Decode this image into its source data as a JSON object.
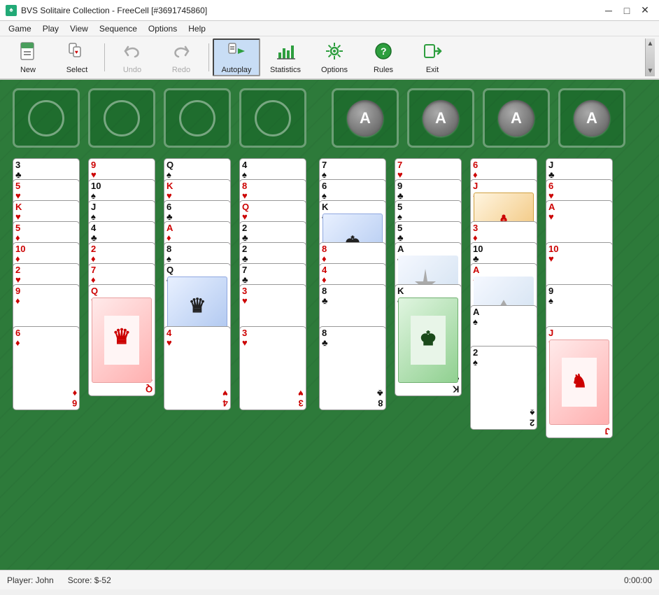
{
  "window": {
    "title": "BVS Solitaire Collection  -  FreeCell [#3691745860]",
    "app_name": "BVS Solitaire Collection",
    "subtitle": "FreeCell [#3691745860]"
  },
  "toolbar": {
    "buttons": [
      {
        "id": "new",
        "label": "New",
        "icon": "📄",
        "disabled": false,
        "active": false
      },
      {
        "id": "select",
        "label": "Select",
        "icon": "🃏",
        "disabled": false,
        "active": false
      },
      {
        "id": "undo",
        "label": "Undo",
        "icon": "↩",
        "disabled": true,
        "active": false
      },
      {
        "id": "redo",
        "label": "Redo",
        "icon": "↪",
        "disabled": true,
        "active": false
      },
      {
        "id": "autoplay",
        "label": "Autoplay",
        "icon": "▶",
        "disabled": false,
        "active": true
      },
      {
        "id": "statistics",
        "label": "Statistics",
        "icon": "📊",
        "disabled": false,
        "active": false
      },
      {
        "id": "options",
        "label": "Options",
        "icon": "⚙",
        "disabled": false,
        "active": false
      },
      {
        "id": "rules",
        "label": "Rules",
        "icon": "❓",
        "disabled": false,
        "active": false
      },
      {
        "id": "exit",
        "label": "Exit",
        "icon": "🚪",
        "disabled": false,
        "active": false
      }
    ]
  },
  "menu": {
    "items": [
      "Game",
      "Play",
      "View",
      "Sequence",
      "Options",
      "Help"
    ]
  },
  "statusbar": {
    "player": "Player: John",
    "score": "Score: $-52",
    "time": "0:00:00"
  }
}
